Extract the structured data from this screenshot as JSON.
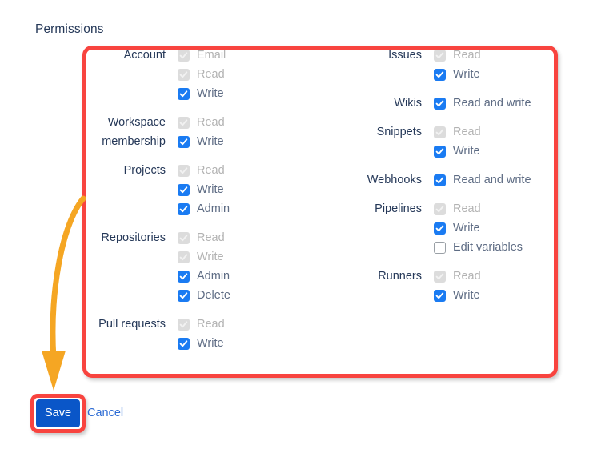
{
  "page": {
    "title": "Permissions"
  },
  "colors": {
    "annotation": "#f8443f",
    "arrow": "#f5a623",
    "checkbox_checked": "#1a7bf2",
    "checkbox_disabled": "#dcdcdc",
    "save_button": "#0a56c8",
    "link": "#2c6bd4",
    "heading_text": "#253858",
    "label_text": "#5e6c84",
    "disabled_text": "#b3b3b3"
  },
  "permissions": {
    "left_column": [
      {
        "label": "Account",
        "options": [
          {
            "label": "Email",
            "state": "disabled"
          },
          {
            "label": "Read",
            "state": "disabled"
          },
          {
            "label": "Write",
            "state": "checked"
          }
        ]
      },
      {
        "label": "Workspace membership",
        "options": [
          {
            "label": "Read",
            "state": "disabled"
          },
          {
            "label": "Write",
            "state": "checked"
          }
        ]
      },
      {
        "label": "Projects",
        "options": [
          {
            "label": "Read",
            "state": "disabled"
          },
          {
            "label": "Write",
            "state": "checked"
          },
          {
            "label": "Admin",
            "state": "checked"
          }
        ]
      },
      {
        "label": "Repositories",
        "options": [
          {
            "label": "Read",
            "state": "disabled"
          },
          {
            "label": "Write",
            "state": "disabled"
          },
          {
            "label": "Admin",
            "state": "checked"
          },
          {
            "label": "Delete",
            "state": "checked"
          }
        ]
      },
      {
        "label": "Pull requests",
        "options": [
          {
            "label": "Read",
            "state": "disabled"
          },
          {
            "label": "Write",
            "state": "checked"
          }
        ]
      }
    ],
    "right_column": [
      {
        "label": "Issues",
        "options": [
          {
            "label": "Read",
            "state": "disabled"
          },
          {
            "label": "Write",
            "state": "checked"
          }
        ]
      },
      {
        "label": "Wikis",
        "options": [
          {
            "label": "Read and write",
            "state": "checked"
          }
        ]
      },
      {
        "label": "Snippets",
        "options": [
          {
            "label": "Read",
            "state": "disabled"
          },
          {
            "label": "Write",
            "state": "checked"
          }
        ]
      },
      {
        "label": "Webhooks",
        "options": [
          {
            "label": "Read and write",
            "state": "checked"
          }
        ]
      },
      {
        "label": "Pipelines",
        "options": [
          {
            "label": "Read",
            "state": "disabled"
          },
          {
            "label": "Write",
            "state": "checked"
          },
          {
            "label": "Edit variables",
            "state": "unchecked"
          }
        ]
      },
      {
        "label": "Runners",
        "options": [
          {
            "label": "Read",
            "state": "disabled"
          },
          {
            "label": "Write",
            "state": "checked"
          }
        ]
      }
    ]
  },
  "footer": {
    "save_label": "Save",
    "cancel_label": "Cancel"
  },
  "annotations": {
    "highlight_box_name": "permissions-highlight",
    "save_highlight_name": "save-highlight",
    "arrow_name": "curved-arrow"
  }
}
